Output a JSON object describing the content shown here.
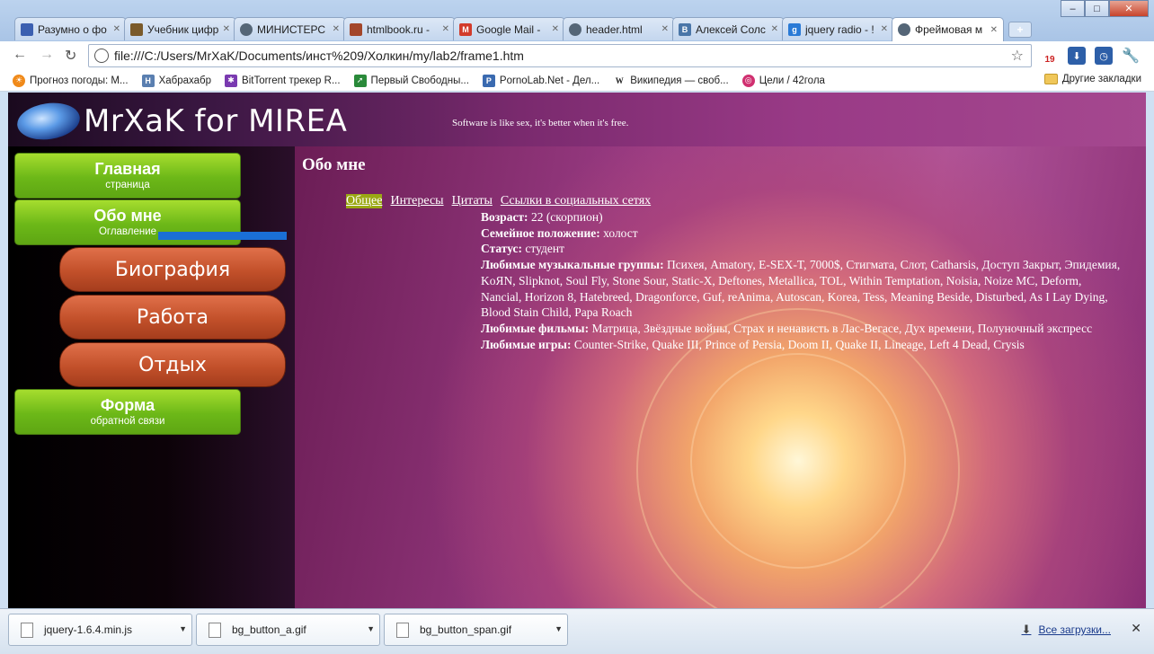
{
  "window": {
    "controls": [
      "–",
      "□",
      "✕"
    ],
    "tabs": [
      {
        "label": "Разумно о фо",
        "icon": "page-icon",
        "color": "#3b5fb0"
      },
      {
        "label": "Учебник цифр",
        "icon": "page-icon",
        "color": "#7a5a2a"
      },
      {
        "label": "МИНИСТЕРС",
        "icon": "globe-icon",
        "color": "#556677"
      },
      {
        "label": "htmlbook.ru -",
        "icon": "page-icon",
        "color": "#a3462a"
      },
      {
        "label": "Google Mail -",
        "icon": "mail-icon",
        "color": "#d23b2b"
      },
      {
        "label": "header.html",
        "icon": "globe-icon",
        "color": "#556677"
      },
      {
        "label": "Алексей Солс",
        "icon": "vk-icon",
        "color": "#4a76a8"
      },
      {
        "label": "jquery radio - !",
        "icon": "google-icon",
        "color": "#2a7ad6"
      },
      {
        "label": "Фреймовая м",
        "icon": "globe-icon",
        "color": "#556677",
        "active": true
      }
    ],
    "newtab": "+"
  },
  "toolbar": {
    "back": "←",
    "forward": "→",
    "reload": "↻",
    "url": "file:///C:/Users/MrXaK/Documents/инст%209/Холкин/my/lab2/frame1.htm",
    "star": "☆",
    "badge": "19"
  },
  "bookmarks": {
    "items": [
      {
        "label": "Прогноз погоды: М...",
        "color": "#f08a1a"
      },
      {
        "label": "Хабрахабр",
        "color": "#5a7fb0"
      },
      {
        "label": "BitTorrent трекер R...",
        "color": "#7a3ab0"
      },
      {
        "label": "Первый Свободны...",
        "color": "#2a8a3a"
      },
      {
        "label": "PornoLab.Net - Дел...",
        "color": "#3a6ab0"
      },
      {
        "label": "Википедия — своб...",
        "color": "#222222"
      },
      {
        "label": "Цели / 42гола",
        "color": "#d03070"
      }
    ],
    "other": "Другие закладки"
  },
  "site": {
    "title": "MrXaK for MIREA",
    "slogan": "Software is like sex, it's better when it's free.",
    "menu": {
      "home_main": "Главная",
      "home_sub": "страница",
      "about_main": "Обо мне",
      "about_sub": "Оглавление",
      "bio": "Биография",
      "work": "Работа",
      "rest": "Отдых",
      "form_main": "Форма",
      "form_sub": "обратной связи"
    },
    "content": {
      "heading": "Обо мне",
      "subnav": [
        "Общее",
        "Интересы",
        "Цитаты",
        "Ссылки в социальных сетях"
      ],
      "age_label": "Возраст:",
      "age_value": " 22 (скорпион)",
      "family_label": "Семейное положение:",
      "family_value": " холост",
      "status_label": "Статус:",
      "status_value": " студент",
      "music_label": "Любимые музыкальные группы:",
      "music_value": " Психея, Amatory, E-SEX-T, 7000$, Стигмата, Слот, Catharsis, Доступ Закрыт, Эпидемия, KoЯN, Slipknot, Soul Fly, Stone Sour, Static-X, Deftones, Metallica, TOL, Within Temptation, Noisia, Noize MC, Deform, Nancial, Horizon 8, Hatebreed, Dragonforce, Guf, reAnima, Autoscan, Korea, Tess, Meaning Beside, Disturbed, As I Lay Dying, Blood Stain Child, Papa Roach",
      "films_label": "Любимые фильмы:",
      "films_value": " Матрица, Звёздные войны, Страх и ненависть в Лас-Вегасе, Дух времени, Полуночный экспресс",
      "games_label": "Любимые игры:",
      "games_value": " Counter-Strike, Quake III, Prince of Persia, Doom II, Quake II, Lineage, Left 4 Dead, Crysis"
    }
  },
  "downloads": {
    "items": [
      "jquery-1.6.4.min.js",
      "bg_button_a.gif",
      "bg_button_span.gif"
    ],
    "all": "Все загрузки...",
    "close": "✕"
  }
}
